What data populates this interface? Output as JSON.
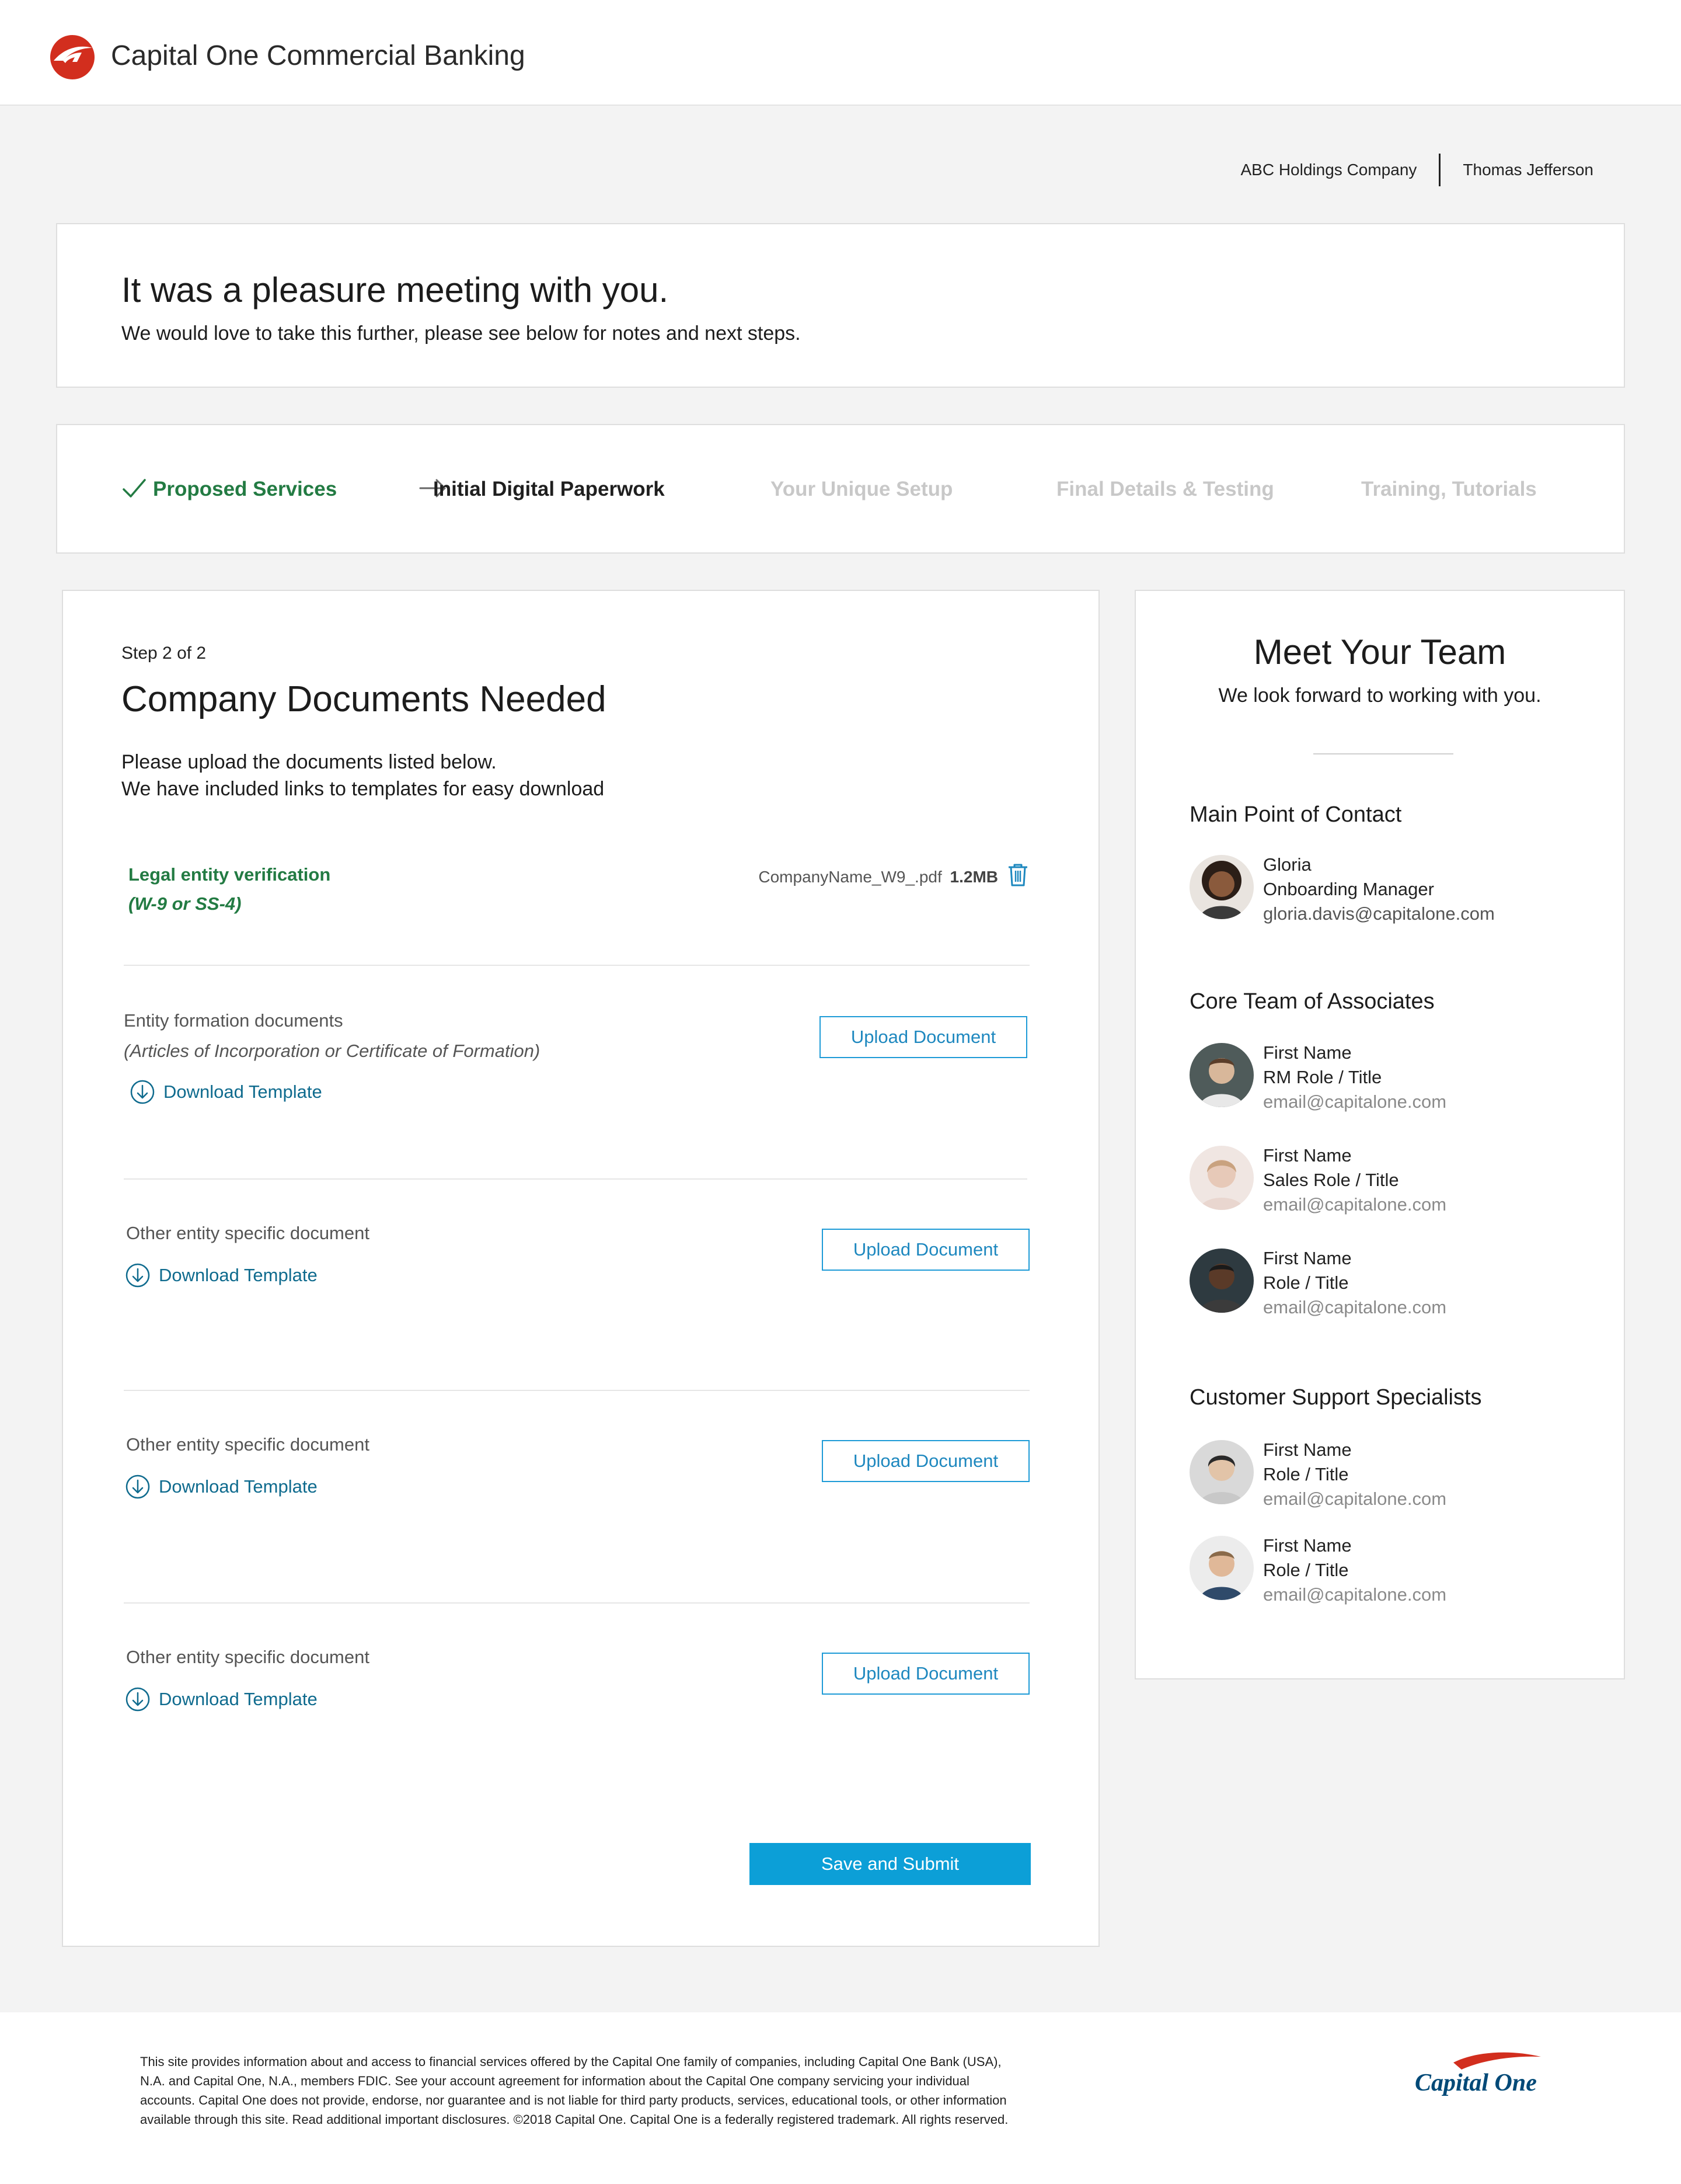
{
  "header": {
    "brand_title": "Capital One Commercial Banking"
  },
  "user_bar": {
    "company": "ABC Holdings Company",
    "user": "Thomas Jefferson"
  },
  "welcome": {
    "title": "It was a pleasure meeting with you.",
    "subtitle": "We would love to take this further, please see below for notes and next steps."
  },
  "progress": {
    "steps": [
      {
        "label": "Proposed Services",
        "state": "done"
      },
      {
        "label": "Initial Digital Paperwork",
        "state": "current"
      },
      {
        "label": "Your Unique Setup",
        "state": "future"
      },
      {
        "label": "Final Details & Testing",
        "state": "future"
      },
      {
        "label": "Training, Tutorials",
        "state": "future"
      }
    ]
  },
  "documents": {
    "step_label": "Step 2 of 2",
    "title": "Company Documents Needed",
    "intro_line1": "Please upload the documents listed below.",
    "intro_line2": "We have included links to templates for easy download",
    "uploaded": {
      "title": "Legal entity verification",
      "subtitle": "(W-9 or SS-4)",
      "file_name": "CompanyName_W9_.pdf",
      "file_size": "1.2MB"
    },
    "items": [
      {
        "title": "Entity formation documents",
        "note": "(Articles of Incorporation or Certificate of Formation)",
        "download_label": "Download Template",
        "upload_label": "Upload Document"
      },
      {
        "title": "Other entity specific document",
        "download_label": "Download Template",
        "upload_label": "Upload Document"
      },
      {
        "title": "Other entity specific document",
        "download_label": "Download Template",
        "upload_label": "Upload Document"
      },
      {
        "title": "Other entity specific document",
        "download_label": "Download Template",
        "upload_label": "Upload Document"
      }
    ],
    "submit_label": "Save and Submit"
  },
  "team": {
    "title": "Meet Your Team",
    "tagline": "We look forward to working with you.",
    "main_contact_title": "Main Point of Contact",
    "main_contact": {
      "name": "Gloria",
      "role": "Onboarding Manager",
      "email": "gloria.davis@capitalone.com"
    },
    "core_title": "Core Team of Associates",
    "core": [
      {
        "name": "First Name",
        "role": "RM Role / Title",
        "email": "email@capitalone.com"
      },
      {
        "name": "First Name",
        "role": "Sales Role / Title",
        "email": "email@capitalone.com"
      },
      {
        "name": "First Name",
        "role": "Role / Title",
        "email": "email@capitalone.com"
      }
    ],
    "support_title": "Customer Support Specialists",
    "support": [
      {
        "name": "First Name",
        "role": "Role / Title",
        "email": "email@capitalone.com"
      },
      {
        "name": "First Name",
        "role": "Role / Title",
        "email": "email@capitalone.com"
      }
    ]
  },
  "footer": {
    "disclaimer": "This site provides information about and access to financial services offered by the Capital One family of companies, including Capital One Bank (USA), N.A. and Capital One, N.A., members FDIC. See your account agreement for information about the Capital One company servicing your individual accounts. Capital One does not provide, endorse, nor guarantee and is not liable for third party products, services, educational tools, or other information available through this site. Read additional important disclosures. ©2018 Capital One. Capital One is a federally registered trademark. All rights reserved.",
    "logo_text": "Capital One"
  },
  "colors": {
    "brand_red": "#d22e1e",
    "success_green": "#237b43",
    "link_teal": "#0f6b8e",
    "primary_blue": "#0c9fd7",
    "brand_navy": "#004977"
  }
}
